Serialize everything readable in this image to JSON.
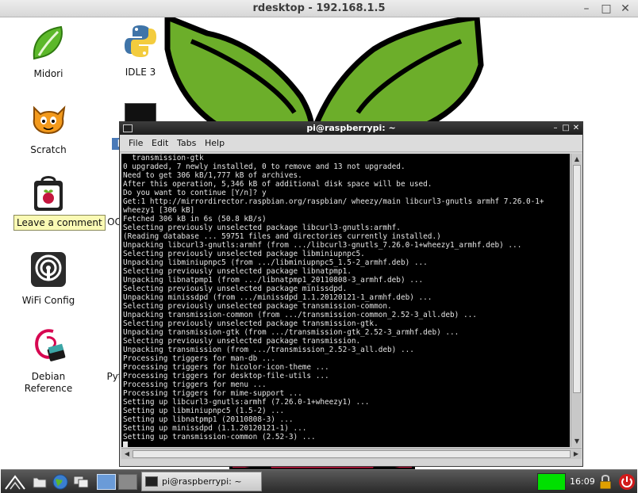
{
  "outer_window": {
    "title": "rdesktop - 192.168.1.5",
    "minimize": "–",
    "maximize": "□",
    "close": "✕"
  },
  "desktop": {
    "icons": [
      {
        "label": "Midori",
        "icon": "midori-icon"
      },
      {
        "label": "IDLE 3",
        "icon": "python-icon"
      },
      {
        "label": "Scratch",
        "icon": "scratch-icon"
      },
      {
        "label": "L",
        "icon": "lxterminal-icon"
      },
      {
        "label": "OC",
        "icon": "ocr-icon"
      },
      {
        "label": "WiFi Config",
        "icon": "wifi-config-icon"
      },
      {
        "label": "Debian\nReference",
        "icon": "debian-icon"
      },
      {
        "label": "Pyt",
        "icon": "python-games-icon"
      }
    ],
    "store_icon": "pi-store-icon",
    "tooltip": "Leave a comment"
  },
  "terminal": {
    "title": "pi@raspberrypi: ~",
    "controls": {
      "minimize": "–",
      "maximize": "□",
      "close": "✕"
    },
    "menu": [
      "File",
      "Edit",
      "Tabs",
      "Help"
    ],
    "lines": [
      "  transmission-gtk",
      "0 upgraded, 7 newly installed, 0 to remove and 13 not upgraded.",
      "Need to get 306 kB/1,777 kB of archives.",
      "After this operation, 5,346 kB of additional disk space will be used.",
      "Do you want to continue [Y/n]? y",
      "Get:1 http://mirrordirector.raspbian.org/raspbian/ wheezy/main libcurl3-gnutls armhf 7.26.0-1+",
      "wheezy1 [306 kB]",
      "Fetched 306 kB in 6s (50.8 kB/s)",
      "Selecting previously unselected package libcurl3-gnutls:armhf.",
      "(Reading database ... 59751 files and directories currently installed.)",
      "Unpacking libcurl3-gnutls:armhf (from .../libcurl3-gnutls_7.26.0-1+wheezy1_armhf.deb) ...",
      "Selecting previously unselected package libminiupnpc5.",
      "Unpacking libminiupnpc5 (from .../libminiupnpc5_1.5-2_armhf.deb) ...",
      "Selecting previously unselected package libnatpmp1.",
      "Unpacking libnatpmp1 (from .../libnatpmp1_20110808-3_armhf.deb) ...",
      "Selecting previously unselected package minissdpd.",
      "Unpacking minissdpd (from .../minissdpd_1.1.20120121-1_armhf.deb) ...",
      "Selecting previously unselected package transmission-common.",
      "Unpacking transmission-common (from .../transmission-common_2.52-3_all.deb) ...",
      "Selecting previously unselected package transmission-gtk.",
      "Unpacking transmission-gtk (from .../transmission-gtk_2.52-3_armhf.deb) ...",
      "Selecting previously unselected package transmission.",
      "Unpacking transmission (from .../transmission_2.52-3_all.deb) ...",
      "Processing triggers for man-db ...",
      "Processing triggers for hicolor-icon-theme ...",
      "Processing triggers for desktop-file-utils ...",
      "Processing triggers for menu ...",
      "Processing triggers for mime-support ...",
      "Setting up libcurl3-gnutls:armhf (7.26.0-1+wheezy1) ...",
      "Setting up libminiupnpc5 (1.5-2) ...",
      "Setting up libnatpmp1 (20110808-3) ...",
      "Setting up minissdpd (1.1.20120121-1) ...",
      "Setting up transmission-common (2.52-3) ..."
    ]
  },
  "taskbar": {
    "task_label": "pi@raspberrypi: ~",
    "clock": "16:09",
    "cpu_color": "#00e000",
    "icons": [
      "start-menu-icon",
      "file-manager-icon",
      "web-browser-icon",
      "window-switch-icon",
      "desktop-1-icon",
      "desktop-2-icon"
    ]
  },
  "colors": {
    "leaf_green": "#6cae2a",
    "raspberry_red": "#c4163e",
    "terminal_bg": "#000000",
    "terminal_fg": "#e6e6e6"
  }
}
